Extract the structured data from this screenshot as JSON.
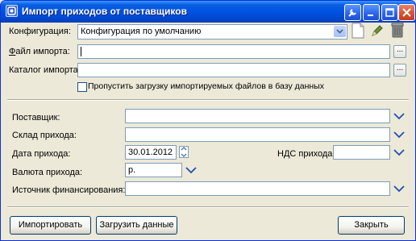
{
  "window": {
    "title": "Импорт приходов от поставщиков",
    "title_icon": "app-icon",
    "buttons": [
      "tools-icon",
      "minimize-icon",
      "maximize-icon",
      "close-icon"
    ]
  },
  "config": {
    "label": "Конфигурация:",
    "value": "Конфигурация по умолчанию",
    "icons": [
      "new-document-icon",
      "pen-icon",
      "trash-icon"
    ]
  },
  "import_file": {
    "label": "Файл импорта:",
    "value": "",
    "browse_label": "..."
  },
  "import_folder": {
    "label": "Каталог импорта:",
    "value": "",
    "browse_label": "..."
  },
  "skip_imported": {
    "label": "Пропустить загрузку импортируемых файлов в базу данных",
    "checked": false
  },
  "supplier": {
    "label": "Поставщик:",
    "value": ""
  },
  "warehouse": {
    "label": "Склад прихода:",
    "value": ""
  },
  "date": {
    "label": "Дата прихода:",
    "value": "30.01.2012"
  },
  "vat": {
    "label": "НДС прихода:",
    "value": ""
  },
  "currency": {
    "label": "Валюта прихода:",
    "value": "р."
  },
  "funding": {
    "label": "Источник финансирования:",
    "value": ""
  },
  "footer": {
    "import_label": "Импортировать",
    "load_label": "Загрузить данные",
    "close_label": "Закрыть"
  },
  "colors": {
    "titlebar": "#0054e3",
    "window_bg": "#ece9d8",
    "field_border": "#7f9db9",
    "chevron": "#1f4fb5"
  }
}
